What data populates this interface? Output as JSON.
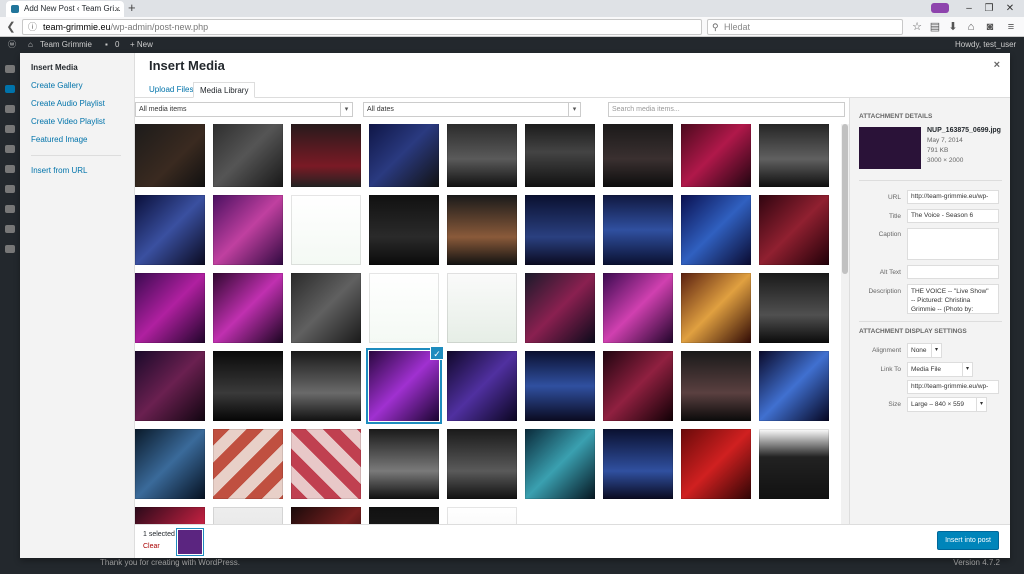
{
  "browser": {
    "tab_title": "Add New Post ‹ Team Gri...",
    "tab_close": "×",
    "new_tab": "+",
    "url_host": "team-grimmie.eu",
    "url_path": "/wp-admin/post-new.php",
    "search_placeholder": "Hledat",
    "win_min": "–",
    "win_max": "❐",
    "win_close": "✕"
  },
  "wp_adminbar": {
    "site_name": "Team Grimmie",
    "comments": "0",
    "new_label": "+ New",
    "howdy": "Howdy, test_user"
  },
  "footer": {
    "thanks": "Thank you for creating with WordPress.",
    "version": "Version 4.7.2"
  },
  "modal": {
    "title": "Insert Media",
    "close": "×",
    "menu": [
      {
        "label": "Insert Media",
        "active": true
      },
      {
        "label": "Create Gallery"
      },
      {
        "label": "Create Audio Playlist"
      },
      {
        "label": "Create Video Playlist"
      },
      {
        "label": "Featured Image"
      },
      {
        "label": "Insert from URL"
      }
    ],
    "tabs": [
      {
        "label": "Upload Files"
      },
      {
        "label": "Media Library",
        "active": true
      }
    ],
    "filters": {
      "type": "All media items",
      "date": "All dates",
      "search_placeholder": "Search media items..."
    },
    "details": {
      "header": "Attachment Details",
      "filename": "NUP_163875_0699.jpg",
      "date": "May 7, 2014",
      "size": "791 KB",
      "dimensions": "3000 × 2000",
      "url_label": "URL",
      "url_value": "http://team-grimmie.eu/wp-",
      "title_label": "Title",
      "title_value": "The Voice - Season 6",
      "caption_label": "Caption",
      "caption_value": "",
      "alt_label": "Alt Text",
      "alt_value": "",
      "desc_label": "Description",
      "desc_value_1": "THE VOICE -- \"Live Show\"",
      "desc_value_2": "-- Pictured: Christina",
      "desc_value_3": "Grimmie -- (Photo by:",
      "display_header": "Attachment Display Settings",
      "alignment_label": "Alignment",
      "alignment_value": "None",
      "linkto_label": "Link To",
      "linkto_value": "Media File",
      "link_url": "http://team-grimmie.eu/wp-",
      "size_label": "Size",
      "size_value": "Large – 840 × 559"
    },
    "bottom": {
      "selected": "1 selected",
      "clear": "Clear",
      "insert": "Insert into post"
    }
  },
  "colors": {
    "accent": "#0073aa",
    "primary_button": "#0085ba",
    "selection": "#1e8cbe",
    "admin_bar": "#23282d"
  },
  "media_tiles": [
    {
      "bg": "linear-gradient(135deg,#1a1a1a,#3a2a20 60%,#101010)"
    },
    {
      "bg": "linear-gradient(135deg,#2a2a2a,#555 50%,#181818)"
    },
    {
      "bg": "linear-gradient(180deg,#1a1a1a,#7a1a25 70%,#222)"
    },
    {
      "bg": "linear-gradient(135deg,#0c1240,#2a3a80 50%,#111)"
    },
    {
      "bg": "linear-gradient(180deg,#222,#5a5a5a 60%,#111)"
    },
    {
      "bg": "linear-gradient(180deg,#111,#444 50%,#111)"
    },
    {
      "bg": "linear-gradient(180deg,#151515,#3a3030 60%,#0d0d0d)"
    },
    {
      "bg": "linear-gradient(135deg,#400818,#b0184a 50%,#200510)"
    },
    {
      "bg": "linear-gradient(180deg,#1a1a1a,#606060 60%,#0f0f0f)"
    },
    {
      "bg": "linear-gradient(135deg,#0a0f3a,#3a50a0 50%,#0a0a20)"
    },
    {
      "bg": "linear-gradient(135deg,#4a1060,#c040a0 50%,#300a40)"
    },
    {
      "bg": "linear-gradient(180deg,#ffffff,#f4f9f4)"
    },
    {
      "bg": "linear-gradient(180deg,#111,#2a2a2a 60%,#0a0a0a)"
    },
    {
      "bg": "linear-gradient(180deg,#1a1a1a,#8a5a3a 60%,#111)"
    },
    {
      "bg": "linear-gradient(180deg,#0a1030,#2a4080 60%,#0a0a20)"
    },
    {
      "bg": "linear-gradient(180deg,#101840,#3050a0 50%,#0a1030)"
    },
    {
      "bg": "linear-gradient(135deg,#0a1050,#3060c0 50%,#0a0a30)"
    },
    {
      "bg": "linear-gradient(135deg,#300510,#902030 50%,#200008)"
    },
    {
      "bg": "linear-gradient(135deg,#3a0a50,#b020a0 50%,#20052a)"
    },
    {
      "bg": "linear-gradient(135deg,#300830,#c030b0 50%,#1a0520)"
    },
    {
      "bg": "linear-gradient(135deg,#2a2a2a,#606060 50%,#1a1a1a)"
    },
    {
      "bg": "linear-gradient(180deg,#ffffff,#f4f9f4)"
    },
    {
      "bg": "linear-gradient(180deg,#fafafa,#e6eee6)"
    },
    {
      "bg": "linear-gradient(135deg,#1a1a2a,#8a2050 50%,#0a0a1a)"
    },
    {
      "bg": "linear-gradient(135deg,#3a0a50,#d040b0 50%,#20052a)"
    },
    {
      "bg": "linear-gradient(135deg,#5a2010,#e0a040 50%,#300a05)"
    },
    {
      "bg": "linear-gradient(180deg,#1a1a1a,#505050 60%,#0a0a0a)"
    },
    {
      "bg": "linear-gradient(135deg,#1a0a2a,#6a2050 50%,#100510)"
    },
    {
      "bg": "linear-gradient(180deg,#0a0a0a,#3a3a3a 60%,#050505)"
    },
    {
      "bg": "linear-gradient(180deg,#1a1a1a,#6a6a6a 60%,#111)"
    },
    {
      "bg": "linear-gradient(135deg,#2a0840,#a030d0 50%,#1a0530)",
      "selected": true
    },
    {
      "bg": "linear-gradient(135deg,#10082a,#5030a0 50%,#0a0520)"
    },
    {
      "bg": "linear-gradient(180deg,#0a1030,#3050a0 50%,#0a0a20)"
    },
    {
      "bg": "linear-gradient(135deg,#200510,#902040 50%,#100005)"
    },
    {
      "bg": "linear-gradient(180deg,#1a1a1a,#5a4040 60%,#0a0a0a)"
    },
    {
      "bg": "linear-gradient(135deg,#0a0a2a,#4070d0 50%,#050520)"
    },
    {
      "bg": "linear-gradient(135deg,#0a1a2a,#3a6a9a 50%,#051020)"
    },
    {
      "bg": "repeating-linear-gradient(135deg,#c05040 0 12px,#e8d0c8 12px 24px)"
    },
    {
      "bg": "repeating-linear-gradient(45deg,#c04050 0 12px,#e8c8c8 12px 24px)"
    },
    {
      "bg": "linear-gradient(180deg,#1a1a1a,#7a7a7a 60%,#101010)"
    },
    {
      "bg": "linear-gradient(180deg,#1a1a1a,#5a5a5a 60%,#111)"
    },
    {
      "bg": "linear-gradient(135deg,#0a2a3a,#3aa0b0 50%,#051520)"
    },
    {
      "bg": "linear-gradient(180deg,#0a1030,#3050a0 60%,#0a0a20)"
    },
    {
      "bg": "linear-gradient(135deg,#6a0a0a,#d02020 50%,#300505)"
    },
    {
      "bg": "linear-gradient(180deg,#ffffff,#222 40%,#111)"
    },
    {
      "bg": "linear-gradient(135deg,#2a0a1a,#c02040 60%,#100008)"
    },
    {
      "bg": "linear-gradient(180deg,#eeeeee,#dddddd)"
    },
    {
      "bg": "linear-gradient(135deg,#1a0a0a,#7a2020 50%,#0a0505)"
    },
    {
      "bg": "linear-gradient(180deg,#111,#2a2a2a)"
    },
    {
      "bg": "linear-gradient(180deg,#ffffff,#eeeeee)"
    }
  ]
}
